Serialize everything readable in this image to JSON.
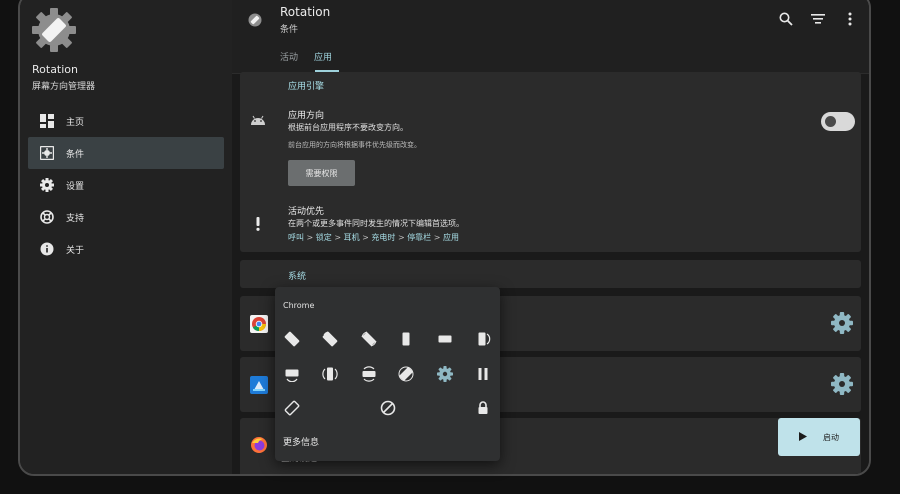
{
  "app": {
    "name": "Rotation",
    "subtitle": "屏幕方向管理器"
  },
  "sidebar": {
    "items": [
      {
        "label": "主页",
        "icon": "dashboard-icon",
        "active": false
      },
      {
        "label": "条件",
        "icon": "conditions-icon",
        "active": true
      },
      {
        "label": "设置",
        "icon": "gear-icon",
        "active": false
      },
      {
        "label": "支持",
        "icon": "support-icon",
        "active": false
      },
      {
        "label": "关于",
        "icon": "info-icon",
        "active": false
      }
    ]
  },
  "header": {
    "title": "Rotation",
    "subtitle": "条件",
    "tabs": [
      "活动",
      "应用"
    ],
    "active_tab": 1,
    "actions": [
      "search-icon",
      "sort-icon",
      "more-vert-icon"
    ]
  },
  "engine": {
    "section_title": "应用引擎",
    "orientation_title": "应用方向",
    "orientation_desc": "根据前台应用程序不要改变方向。",
    "orientation_note": "前台应用的方向将根据事件优先级而改变。",
    "permission_button": "需要权限",
    "toggle_on": false,
    "priority_title": "活动优先",
    "priority_desc": "在两个或更多事件同时发生的情况下编辑首选项。",
    "priority_chain": [
      "呼叫",
      "锁定",
      "耳机",
      "充电时",
      "停靠栏",
      "应用"
    ],
    "chain_separator": ">"
  },
  "system": {
    "section_title": "系统"
  },
  "apps": [
    {
      "icon": "chrome-icon",
      "action": "gear-icon"
    },
    {
      "icon": "app-blue-icon",
      "action": "gear-icon"
    },
    {
      "icon": "firefox-icon",
      "action": "start"
    }
  ],
  "global_label": "全局设定",
  "start_button": {
    "label": "启动",
    "icon": "play-icon"
  },
  "popup": {
    "title": "Chrome",
    "more_label": "更多信息",
    "icons": [
      "rotate-left-icon",
      "rotate-right-icon",
      "auto-rotate-icon",
      "portrait-icon",
      "landscape-icon",
      "reverse-portrait-icon",
      "landscape-tilt-icon",
      "rotate-lock-both-icon",
      "sensor-landscape-icon",
      "full-sensor-icon",
      "gear-icon",
      "pause-icon",
      "sensor-portrait-icon",
      "block-icon",
      "lock-icon"
    ]
  },
  "colors": {
    "accent": "#9ed1db",
    "background": "#1d1d1d",
    "card": "#2b2b2b",
    "active_nav": "#3a4144",
    "start_button": "#bfe2ea",
    "gear": "#8fb8c4"
  }
}
